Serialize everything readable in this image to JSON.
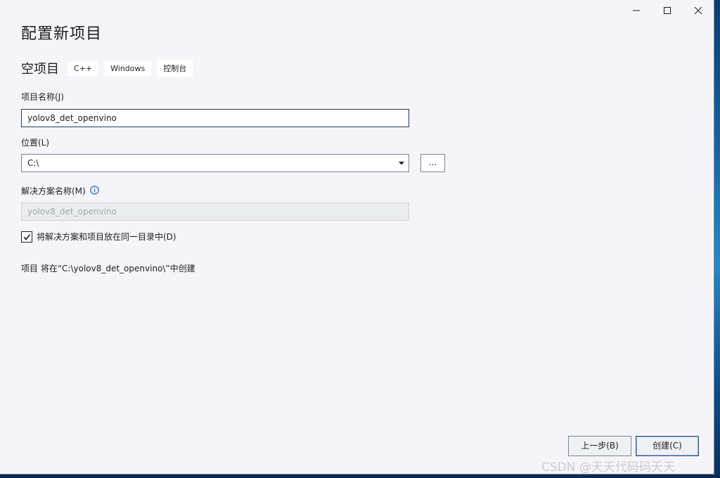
{
  "window": {
    "controls": {
      "minimize_icon": "minimize-icon",
      "maximize_icon": "maximize-icon",
      "close_icon": "close-icon"
    }
  },
  "page_title": "配置新项目",
  "template": {
    "name": "空项目",
    "tags": [
      "C++",
      "Windows",
      "控制台"
    ]
  },
  "project_name": {
    "label": "项目名称(J)",
    "value": "yolov8_det_openvino"
  },
  "location": {
    "label": "位置(L)",
    "value": "C:\\",
    "browse_label": "..."
  },
  "solution_name": {
    "label": "解决方案名称(M)",
    "value": "yolov8_det_openvino",
    "info_icon": "info-icon"
  },
  "same_dir": {
    "checked": true,
    "label": "将解决方案和项目放在同一目录中(D)"
  },
  "path_note": "项目 将在“C:\\yolov8_det_openvino\\”中创建",
  "footer": {
    "back_label": "上一步(B)",
    "create_label": "创建(C)"
  },
  "watermark": "CSDN @天天代码码天天",
  "colors": {
    "window_bg": "#f5f5f9",
    "accent_border": "#2c5a9a",
    "disabled_text": "#a4a8b0",
    "info_blue": "#1b6ac9"
  }
}
